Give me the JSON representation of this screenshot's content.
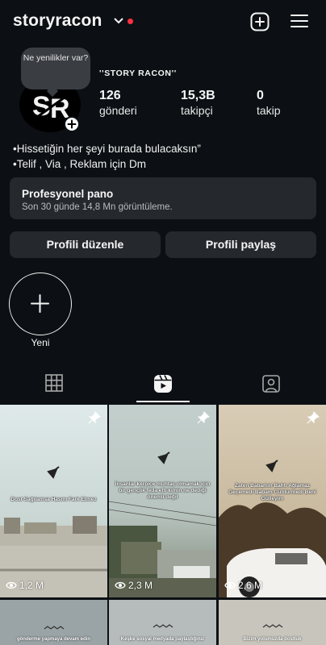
{
  "header": {
    "username": "storyracon"
  },
  "profile": {
    "note_bubble": "Ne yenilikler var?",
    "full_name": "''STORY RACON''",
    "stats": [
      {
        "num": "126",
        "label": "gönderi"
      },
      {
        "num": "15,3B",
        "label": "takipçi"
      },
      {
        "num": "0",
        "label": "takip"
      }
    ],
    "bio": [
      "•Hissetiğin her şeyi burada bulacaksın”",
      "•Telif , Via , Reklam için Dm"
    ]
  },
  "dashboard": {
    "title": "Profesyonel pano",
    "subtitle": "Son 30 günde 14,8 Mn görüntüleme."
  },
  "buttons": {
    "edit": "Profili düzenle",
    "share": "Profili paylaş"
  },
  "highlight": {
    "new_label": "Yeni"
  },
  "colors": {
    "background": "#0c1014",
    "button": "#25292e",
    "notification_dot": "#ff3040"
  },
  "tabs": [
    "grid-icon",
    "reels-icon",
    "tagged-icon"
  ],
  "posts": [
    {
      "caption": "Dost Sağılamsa Hasım Fark Etmez",
      "views": "1,2 M",
      "pinned": true
    },
    {
      "caption": "İnsanlar kerpiçe muhtaç olmamak için bir gençlik feda etti kimin ne dediği önemli değil",
      "views": "2,3 M",
      "pinned": true
    },
    {
      "caption": "Zaten Babamın Bahtı Ağlamaz Geçemedi Babam Güldürmedi Beni Gülleyim",
      "views": "2,6 M",
      "pinned": true
    },
    {
      "caption": "gönderme yapmaya devam edin",
      "views": "",
      "pinned": false
    },
    {
      "caption": "Keşke sosyal medyada paylaştığınız",
      "views": "",
      "pinned": false
    },
    {
      "caption": "Bizim yolumuzda dostluk",
      "views": "",
      "pinned": false
    }
  ]
}
